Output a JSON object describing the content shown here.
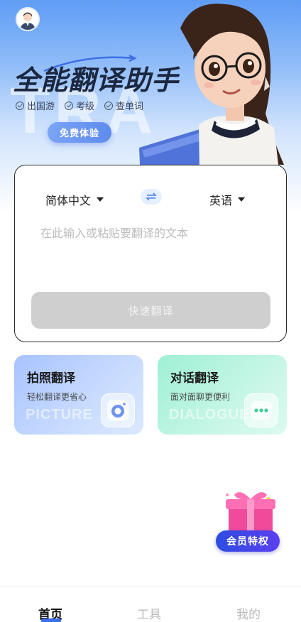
{
  "hero": {
    "title": "全能翻译助手",
    "watermark": "TRA",
    "features": [
      "出国游",
      "考级",
      "查单词"
    ],
    "free_trial": "免费体验"
  },
  "translator": {
    "source_lang": "简体中文",
    "target_lang": "英语",
    "placeholder": "在此输入或粘贴要翻译的文本",
    "submit": "快速翻译"
  },
  "cards": [
    {
      "title": "拍照翻译",
      "subtitle": "轻松翻译更省心",
      "watermark": "PICTURE",
      "icon": "camera-icon"
    },
    {
      "title": "对话翻译",
      "subtitle": "面对面聊更便利",
      "watermark": "DIALOGUE",
      "icon": "chat-icon"
    }
  ],
  "vip": {
    "label": "会员特权"
  },
  "tabs": [
    "首页",
    "工具",
    "我的"
  ],
  "colors": {
    "accent": "#3d6fe8",
    "hero_top": "#5f9df5",
    "photo_card": "#a8c3ff",
    "dialog_card": "#9ff0d4"
  }
}
